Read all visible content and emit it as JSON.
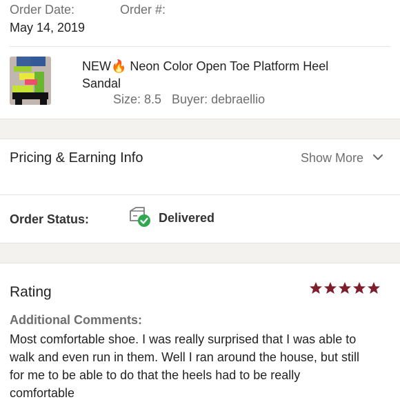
{
  "order": {
    "date_label": "Order Date:",
    "date_value": "May 14, 2019",
    "number_label": "Order #:"
  },
  "item": {
    "title_line1": "NEW🔥 Neon Color Open Toe Platform Heel",
    "title_line2": "Sandal",
    "details": "Size: 8.5   Buyer: debraellio"
  },
  "pricing": {
    "title": "Pricing & Earning Info",
    "show_more": "Show More"
  },
  "status": {
    "label": "Order Status:",
    "value": "Delivered"
  },
  "rating": {
    "title": "Rating",
    "stars": 5,
    "comments_label": "Additional Comments:",
    "comments_lines": [
      "Most comfortable shoe. I was really surprised that I was able to",
      "walk and even run in them. Well I ran around the house, but still",
      "for me to be able to do that the heels had to be really",
      "comfortable"
    ]
  },
  "colors": {
    "accent": "#7c1f2b",
    "delivered_check": "#2fa84f"
  },
  "icons": {
    "chevron": "chevron-down-icon",
    "status": "package-delivered-icon",
    "star": "star-icon"
  }
}
